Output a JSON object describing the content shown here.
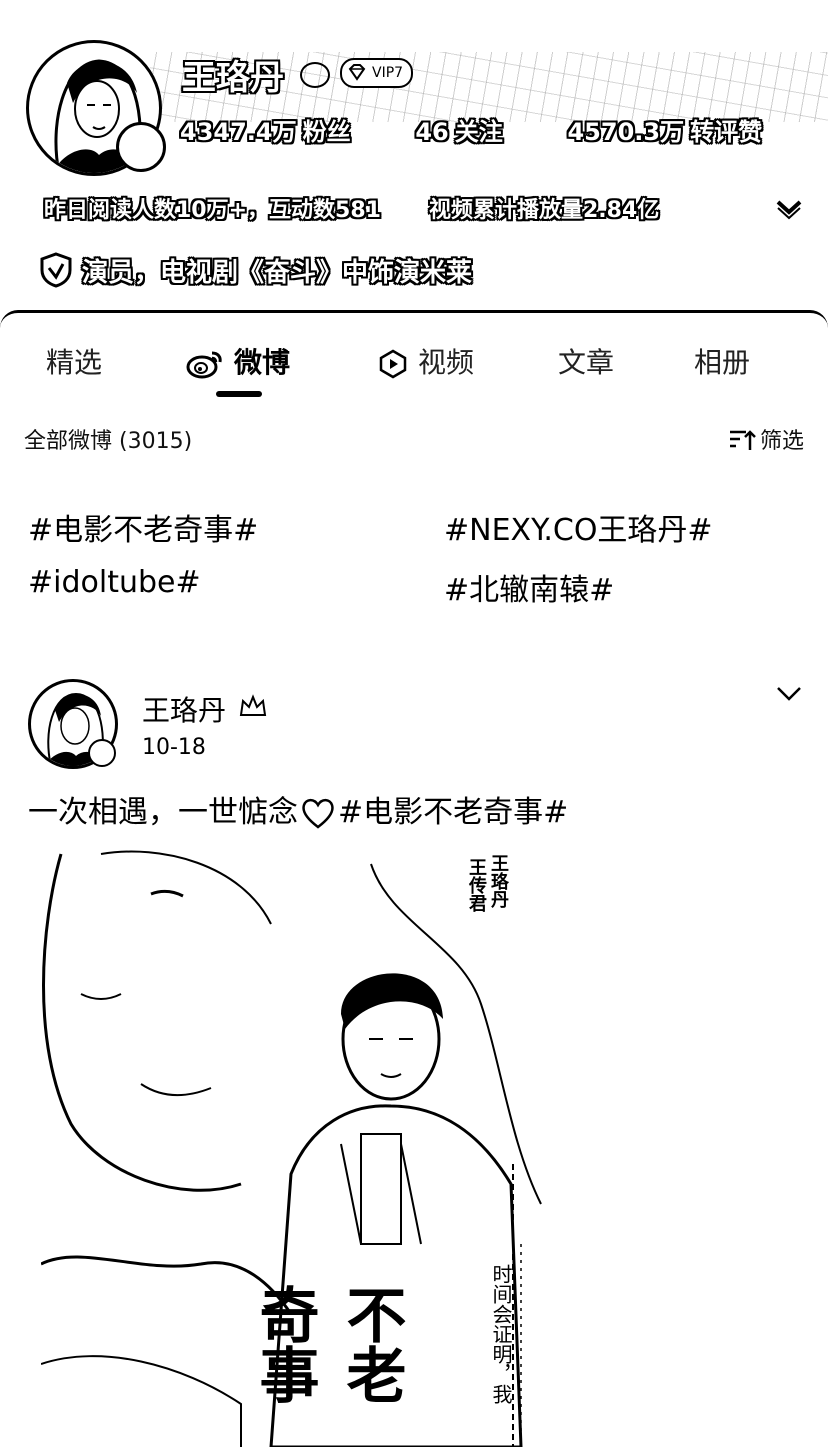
{
  "profile": {
    "name": "王珞丹",
    "vip_label": "VIP7",
    "stats": [
      {
        "value": "4347.4万",
        "label": "粉丝"
      },
      {
        "value": "46",
        "label": "关注"
      },
      {
        "value": "4570.3万",
        "label": "转评赞"
      }
    ],
    "read_info": "昨日阅读人数10万+，互动数581",
    "video_info": "视频累计播放量2.84亿",
    "certification": "演员，电视剧《奋斗》中饰演米莱"
  },
  "tabs": [
    {
      "label": "精选",
      "active": false
    },
    {
      "label": "微博",
      "active": true,
      "icon": "weibo-icon"
    },
    {
      "label": "视频",
      "active": false,
      "icon": "video-icon"
    },
    {
      "label": "文章",
      "active": false
    },
    {
      "label": "相册",
      "active": false
    }
  ],
  "feed": {
    "all_label": "全部微博 (3015)",
    "filter_label": "筛选"
  },
  "topics": [
    "#电影不老奇事#",
    "#NEXY.CO王珞丹#",
    "#idoltube#",
    "#北辙南辕#"
  ],
  "post": {
    "author": "王珞丹",
    "date": "10-18",
    "text_before": "一次相遇，一世惦念",
    "text_after": "#电影不老奇事#",
    "poster": {
      "names": "王珞丹",
      "names2": "王传君",
      "caption": "时间会证明，我",
      "title": "不老奇事"
    }
  }
}
